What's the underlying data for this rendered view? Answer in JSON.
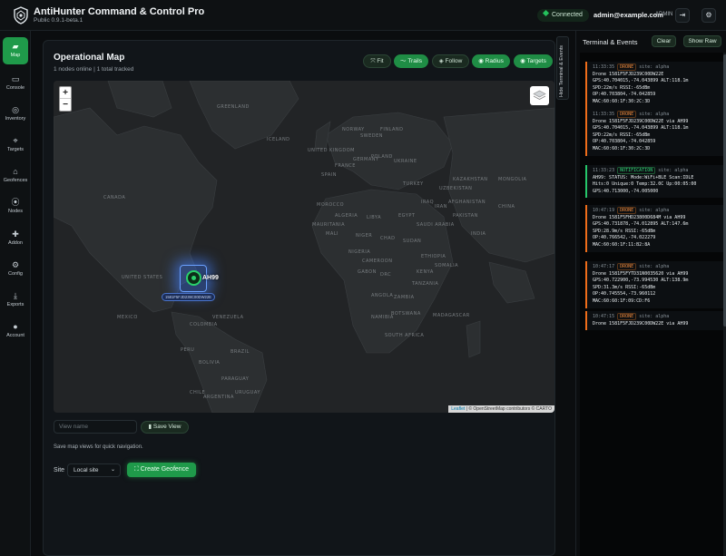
{
  "header": {
    "title": "AntiHunter Command & Control Pro",
    "version": "Public 0.9.1-beta.1",
    "status": "Connected",
    "user": "admin@example.com",
    "role": "ADMIN"
  },
  "sidebar": {
    "items": [
      {
        "label": "Map",
        "icon": "map-icon"
      },
      {
        "label": "Console",
        "icon": "terminal-icon"
      },
      {
        "label": "Inventory",
        "icon": "wifi-icon"
      },
      {
        "label": "Targets",
        "icon": "crosshair-icon"
      },
      {
        "label": "Geofences",
        "icon": "fence-icon"
      },
      {
        "label": "Nodes",
        "icon": "nodes-icon"
      },
      {
        "label": "Addon",
        "icon": "puzzle-icon"
      },
      {
        "label": "Config",
        "icon": "gear-icon"
      },
      {
        "label": "Exports",
        "icon": "download-icon"
      },
      {
        "label": "Account",
        "icon": "user-icon"
      }
    ]
  },
  "map_panel": {
    "title": "Operational Map",
    "subtitle": "1 nodes online | 1 total tracked",
    "toolbar": {
      "fit": "Fit",
      "trails": "Trails",
      "follow": "Follow",
      "radius": "Radius",
      "targets": "Targets"
    },
    "map_labels": {
      "canada": "CANADA",
      "greenland": "GREENLAND",
      "iceland": "ICELAND",
      "united_states": "UNITED STATES",
      "mexico": "MEXICO",
      "brazil": "BRAZIL",
      "bolivia": "BOLIVIA",
      "peru": "PERU",
      "argentina": "ARGENTINA",
      "algeria": "ALGERIA",
      "libya": "LIBYA",
      "mali": "MALI",
      "niger": "NIGER",
      "chad": "CHAD",
      "sudan": "SUDAN",
      "nigeria": "NIGERIA",
      "ethiopia": "ETHIOPIA",
      "drc": "DRC",
      "kenya": "KENYA",
      "angola": "ANGOLA",
      "namibia": "NAMIBIA",
      "south_africa": "SOUTH AFRICA",
      "madagascar": "MADAGASCAR",
      "kazakhstan": "KAZAKHSTAN",
      "mongolia": "MONGOLIA",
      "china": "CHINA",
      "india": "INDIA",
      "iran": "IRAN",
      "saudi_arabia": "SAUDI ARABIA",
      "france": "FRANCE",
      "ukraine": "UKRAINE",
      "sweden": "SWEDEN",
      "finland": "FINLAND",
      "norway": "NORWAY",
      "united_kingdom": "UNITED KINGDOM",
      "egypt": "EGYPT",
      "turkey": "TURKEY",
      "spain": "SPAIN",
      "germany": "GERMANY",
      "poland": "POLAND",
      "iraq": "IRAQ",
      "pakistan": "PAKISTAN",
      "afghanistan": "AFGHANISTAN",
      "venezuela": "VENEZUELA",
      "colombia": "COLOMBIA",
      "chile": "CHILE",
      "paraguay": "PARAGUAY",
      "uruguay": "URUGUAY",
      "zambia": "ZAMBIA",
      "botswana": "BOTSWANA",
      "tanzania": "TANZANIA",
      "somalia": "SOMALIA",
      "morocco": "MOROCCO",
      "mauritania": "MAURITANIA",
      "cameroon": "CAMEROON",
      "gabon": "GABON",
      "uzbekistan": "UZBEKISTAN"
    },
    "node_label": "AH99",
    "drone_label": "1581F5FJD239C00DW22E",
    "attribution_leaflet": "Leaflet",
    "attribution_rest": "| © OpenStreetMap contributors © CARTO",
    "view_name_placeholder": "View name",
    "save_view": "Save View",
    "hint": "Save map views for quick navigation.",
    "site_label": "Site",
    "site_value": "Local site",
    "create_geofence": "Create Geofence"
  },
  "hide_tab": "Hide Terminal & Events",
  "terminal": {
    "title": "Terminal & Events",
    "clear": "Clear",
    "show_raw": "Show Raw",
    "entries": [
      {
        "time": "11:33:35",
        "tag": "DRONE",
        "site": "site: alpha",
        "kind": "drone",
        "lines": [
          "Drone 1581F5FJD239C00DW22E",
          "GPS:40.704015,-74.043899 ALT:118.1m",
          "SPD:22m/s RSSI:-65dBm",
          "OP:40.703804,-74.042859",
          "MAC:60:60:1F:30:2C:3D"
        ]
      },
      {
        "time": "11:33:35",
        "tag": "DRONE",
        "site": "site: alpha",
        "kind": "drone",
        "lines": [
          "Drone 1581F5FJD239C00DW22E via AH99",
          "GPS:40.704015,-74.043899 ALT:118.1m",
          "SPD:22m/s RSSI:-65dBm",
          "OP:40.703804,-74.042859",
          "MAC:60:60:1F:30:2C:3D"
        ]
      },
      {
        "time": "11:33:23",
        "tag": "NOTIFICATION",
        "site": "site: alpha",
        "kind": "notif",
        "lines": [
          "AH99: STATUS: Mode:WiFi+BLE Scan:IDLE",
          "Hits:0 Unique:0 Temp:32.0C Up:00:05:00",
          "GPS:40.713000,-74.005000"
        ]
      },
      {
        "time": "10:47:19",
        "tag": "DRONE",
        "site": "site: alpha",
        "kind": "drone",
        "lines": [
          "Drone 1581F5FHD23800D684M via AH99",
          "GPS:40.731878,-74.012895 ALT:147.6m",
          "SPD:28.9m/s RSSI:-65dBm",
          "OP:40.766542,-74.022279",
          "MAC:60:60:1F:11:B2:8A"
        ]
      },
      {
        "time": "10:47:17",
        "tag": "DRONE",
        "site": "site: alpha",
        "kind": "drone",
        "lines": [
          "Drone 1581F5FYTD31N0035620 via AH99",
          "GPS:40.722900,-73.994530 ALT:138.9m",
          "SPD:31.3m/s RSSI:-65dBm",
          "OP:40.745554,-73.960112",
          "MAC:60:60:1F:09:CD:F6"
        ]
      },
      {
        "time": "10:47:15",
        "tag": "DRONE",
        "site": "site: alpha",
        "kind": "drone",
        "lines": [
          "Drone 1581F5FJD239C00DW22E via AH99"
        ]
      }
    ]
  }
}
